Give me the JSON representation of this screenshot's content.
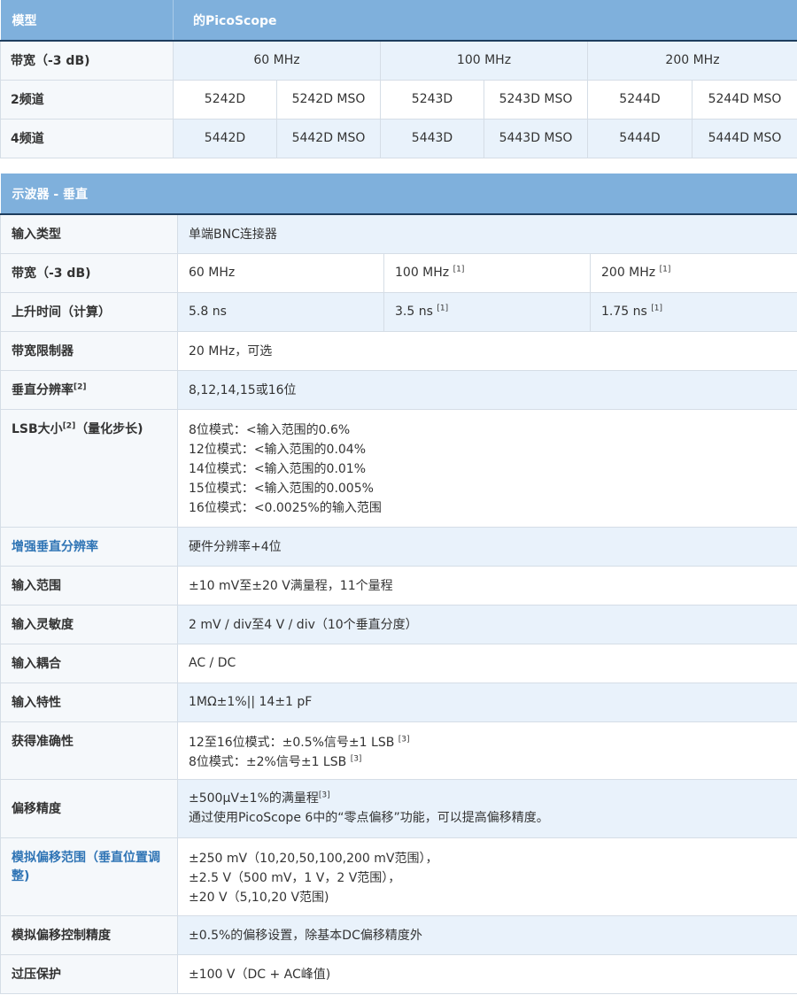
{
  "models_table": {
    "header_label": "模型",
    "header_value": "的PicoScope",
    "bandwidth_row": {
      "label": "带宽（-3 dB)",
      "values": [
        "60 MHz",
        "100 MHz",
        "200 MHz"
      ]
    },
    "two_channel_row": {
      "label": "2频道",
      "values": [
        "5242D",
        "5242D MSO",
        "5243D",
        "5243D MSO",
        "5244D",
        "5244D MSO"
      ]
    },
    "four_channel_row": {
      "label": "4频道",
      "values": [
        "5442D",
        "5442D MSO",
        "5443D",
        "5443D MSO",
        "5444D",
        "5444D MSO"
      ]
    }
  },
  "spec_table": {
    "title": "示波器 - 垂直",
    "input_type": {
      "label": "输入类型",
      "value": "单端BNC连接器"
    },
    "bandwidth": {
      "label": "带宽（-3 dB)",
      "values": [
        "60 MHz",
        "100 MHz ",
        "200 MHz "
      ],
      "notes": [
        "",
        "[1]",
        "[1]"
      ]
    },
    "rise_time": {
      "label": "上升时间（计算）",
      "values": [
        "5.8 ns",
        "3.5 ns ",
        "1.75 ns "
      ],
      "notes": [
        "",
        "[1]",
        "[1]"
      ]
    },
    "bandwidth_limiter": {
      "label": "带宽限制器",
      "value": "20 MHz，可选"
    },
    "vertical_resolution": {
      "label": "垂直分辨率",
      "note": "[2]",
      "value": "8,12,14,15或16位"
    },
    "lsb_size": {
      "label_a": "LSB大小",
      "note": "[2]",
      "label_b": "（量化步长)",
      "lines": [
        "8位模式：<输入范围的0.6%",
        "12位模式：<输入范围的0.04%",
        "14位模式：<输入范围的0.01%",
        "15位模式：<输入范围的0.005%",
        "16位模式：<0.0025%的输入范围"
      ]
    },
    "enhanced_resolution": {
      "label": "增强垂直分辨率",
      "value": "硬件分辨率+4位"
    },
    "input_range": {
      "label": "输入范围",
      "value": "±10 mV至±20 V满量程，11个量程"
    },
    "input_sensitivity": {
      "label": "输入灵敏度",
      "value": "2 mV / div至4 V / div（10个垂直分度）"
    },
    "input_coupling": {
      "label": "输入耦合",
      "value": "AC / DC"
    },
    "input_characteristics": {
      "label": "输入特性",
      "value": "1MΩ±1%|| 14±1 pF"
    },
    "gain_accuracy": {
      "label": "获得准确性",
      "lines": [
        "12至16位模式：±0.5%信号±1 LSB ",
        "8位模式：±2%信号±1 LSB "
      ],
      "notes": [
        "[3]",
        "[3]"
      ]
    },
    "offset_accuracy": {
      "label": "偏移精度",
      "line1": "±500μV±1%的满量程",
      "line1_note": "[3]",
      "line2": "通过使用PicoScope 6中的“零点偏移”功能，可以提高偏移精度。"
    },
    "analog_offset_range": {
      "label": "模拟偏移范围（垂直位置调整)",
      "lines": [
        "±250 mV（10,20,50,100,200 mV范围），",
        "±2.5 V（500 mV，1 V，2 V范围），",
        "±20 V（5,10,20 V范围)"
      ]
    },
    "analog_offset_control": {
      "label": "模拟偏移控制精度",
      "value": "±0.5%的偏移设置，除基本DC偏移精度外"
    },
    "overvoltage_protection": {
      "label": "过压保护",
      "value": "±100 V（DC + AC峰值)"
    }
  }
}
